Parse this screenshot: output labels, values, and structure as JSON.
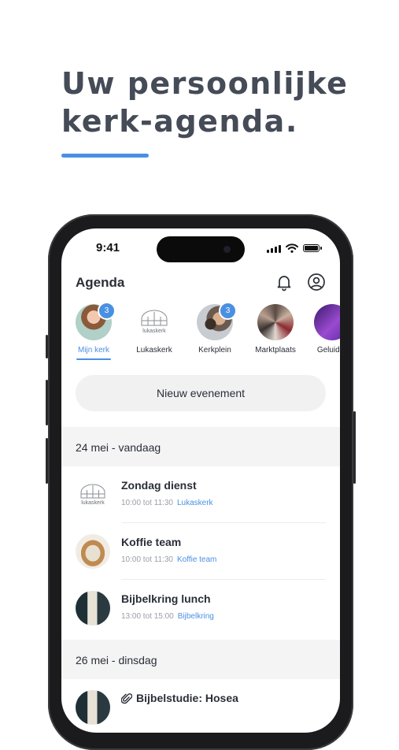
{
  "hero": {
    "title": "Uw persoonlijke\nkerk-agenda."
  },
  "status_bar": {
    "time": "9:41"
  },
  "header": {
    "title": "Agenda",
    "bell_icon": "bell-icon",
    "profile_icon": "user-circle-icon"
  },
  "circles": [
    {
      "label": "Mijn kerk",
      "badge": "3",
      "active": true
    },
    {
      "label": "Lukaskerk",
      "logo_text": "lukaskerk"
    },
    {
      "label": "Kerkplein",
      "badge": "3"
    },
    {
      "label": "Marktplaats"
    },
    {
      "label": "Geluid &"
    }
  ],
  "new_event_label": "Nieuw evenement",
  "sections": [
    {
      "date": "24 mei - vandaag",
      "events": [
        {
          "title": "Zondag dienst",
          "time": "10:00 tot 11:30",
          "group": "Lukaskerk",
          "logo_text": "lukaskerk"
        },
        {
          "title": "Koffie team",
          "time": "10:00 tot 11:30",
          "group": "Koffie team"
        },
        {
          "title": "Bijbelkring lunch",
          "time": "13:00 tot 15:00",
          "group": "Bijbelkring"
        }
      ]
    },
    {
      "date": "26 mei - dinsdag",
      "events": [
        {
          "title": "Bijbelstudie: Hosea",
          "attachment_icon": "paperclip-icon"
        }
      ]
    }
  ],
  "colors": {
    "accent": "#4a90e2",
    "hero_text": "#454b57"
  }
}
